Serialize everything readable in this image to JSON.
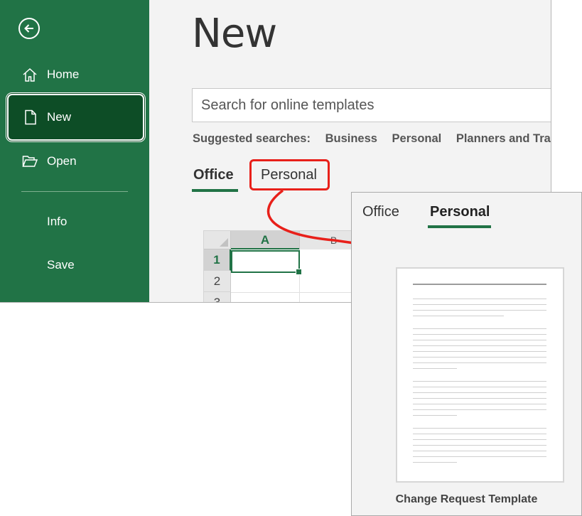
{
  "sidebar": {
    "items": [
      {
        "label": "Home",
        "icon": "home-icon"
      },
      {
        "label": "New",
        "icon": "new-document-icon",
        "selected": true
      },
      {
        "label": "Open",
        "icon": "folder-open-icon"
      },
      {
        "label": "Info"
      },
      {
        "label": "Save"
      }
    ],
    "back_icon": "back-arrow-icon"
  },
  "main": {
    "title": "New",
    "search": {
      "placeholder": "Search for online templates"
    },
    "suggested": {
      "label": "Suggested searches:",
      "links": [
        "Business",
        "Personal",
        "Planners and Trac"
      ]
    },
    "tabs": [
      {
        "label": "Office",
        "active": true
      },
      {
        "label": "Personal",
        "highlighted": true
      }
    ],
    "sheet": {
      "columns": [
        "A",
        "B"
      ],
      "rows": [
        "1",
        "2",
        "3"
      ]
    }
  },
  "callout": {
    "tabs": [
      {
        "label": "Office"
      },
      {
        "label": "Personal",
        "active": true
      }
    ],
    "template_name": "Change Request Template"
  },
  "colors": {
    "brand_green": "#217346",
    "selected_green": "#0d4d26",
    "highlight_red": "#e8201a"
  }
}
